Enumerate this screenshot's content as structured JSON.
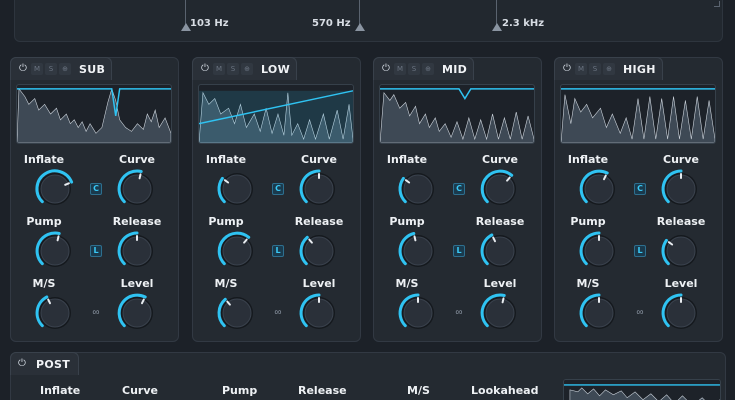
{
  "crossover": {
    "frequencies": [
      "103 Hz",
      "570 Hz",
      "2.3 kHz"
    ]
  },
  "tools": {
    "power": "⏻",
    "mute": "M",
    "solo": "S",
    "link": "⊕"
  },
  "bands": [
    {
      "name": "SUB",
      "inflate_label": "Inflate",
      "curve_label": "Curve",
      "pump_label": "Pump",
      "release_label": "Release",
      "ms_label": "M/S",
      "level_label": "Level",
      "curve_badge": "C",
      "pump_badge": "L",
      "knobs": {
        "inflate": 0.75,
        "curve": 0.55,
        "pump": 0.55,
        "release": 0.5,
        "ms": 0.4,
        "level": 0.6
      }
    },
    {
      "name": "LOW",
      "inflate_label": "Inflate",
      "curve_label": "Curve",
      "pump_label": "Pump",
      "release_label": "Release",
      "ms_label": "M/S",
      "level_label": "Level",
      "curve_badge": "C",
      "pump_badge": "L",
      "knobs": {
        "inflate": 0.3,
        "curve": 0.5,
        "pump": 0.65,
        "release": 0.35,
        "ms": 0.35,
        "level": 0.5
      }
    },
    {
      "name": "MID",
      "inflate_label": "Inflate",
      "curve_label": "Curve",
      "pump_label": "Pump",
      "release_label": "Release",
      "ms_label": "M/S",
      "level_label": "Level",
      "curve_badge": "C",
      "pump_badge": "L",
      "knobs": {
        "inflate": 0.3,
        "curve": 0.65,
        "pump": 0.45,
        "release": 0.4,
        "ms": 0.5,
        "level": 0.55
      }
    },
    {
      "name": "HIGH",
      "inflate_label": "Inflate",
      "curve_label": "Curve",
      "pump_label": "Pump",
      "release_label": "Release",
      "ms_label": "M/S",
      "level_label": "Level",
      "curve_badge": "C",
      "pump_badge": "L",
      "knobs": {
        "inflate": 0.6,
        "curve": 0.5,
        "pump": 0.5,
        "release": 0.3,
        "ms": 0.5,
        "level": 0.5
      }
    }
  ],
  "post": {
    "name": "POST",
    "labels": [
      "Inflate",
      "Curve",
      "Pump",
      "Release",
      "M/S",
      "Lookahead"
    ]
  },
  "colors": {
    "accent": "#2fc3f2",
    "panel": "#242a31",
    "background": "#1c2128"
  }
}
